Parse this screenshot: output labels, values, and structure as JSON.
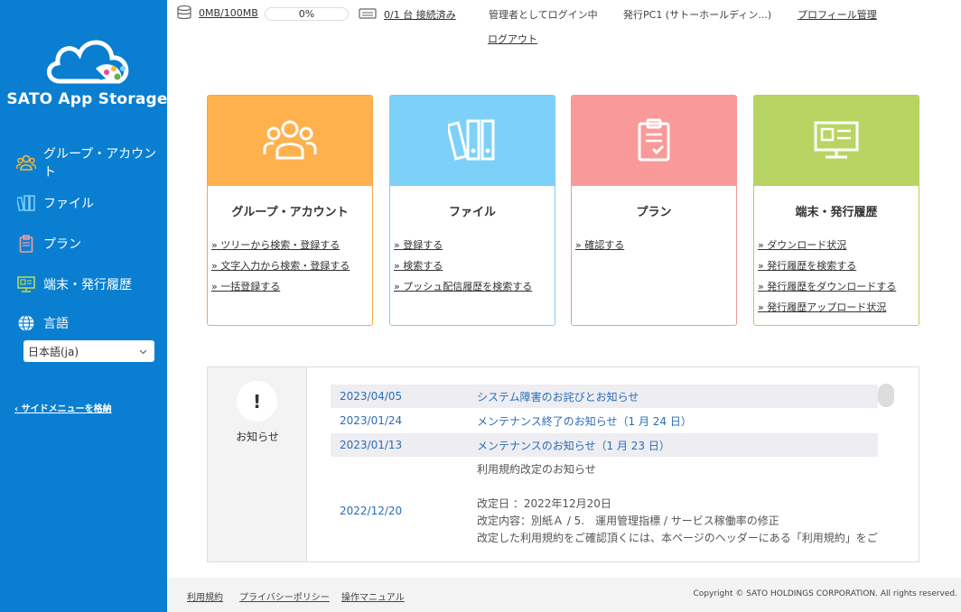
{
  "sidebar": {
    "logo_text": "SATO App Storage",
    "items": [
      {
        "label": "グループ・アカウント",
        "icon": "users-icon"
      },
      {
        "label": "ファイル",
        "icon": "folders-icon"
      },
      {
        "label": "プラン",
        "icon": "clipboard-icon"
      },
      {
        "label": "端末・発行履歴",
        "icon": "monitor-icon"
      },
      {
        "label": "言語",
        "icon": "globe-icon"
      }
    ],
    "language_value": "日本語(ja)",
    "collapse_label": "‹ サイドメニューを格納"
  },
  "header": {
    "storage": "0MB/100MB",
    "storage_percent": "0%",
    "devices": "0/1 台 接続済み",
    "login_status": "管理者としてログイン中",
    "issuing_pc": "発行PC1 (サトーホールディン...)",
    "profile_link": "プロフィール管理",
    "logout_link": "ログアウト"
  },
  "cards": [
    {
      "title": "グループ・アカウント",
      "color": "#ffb14e",
      "border": "#f4a94a",
      "icon": "users-icon",
      "links": [
        "» ツリーから検索・登録する",
        "» 文字入力から検索・登録する",
        "» 一括登録する"
      ]
    },
    {
      "title": "ファイル",
      "color": "#7dd1f8",
      "border": "#7dcdf2",
      "icon": "folders-icon",
      "links": [
        "» 登録する",
        "» 検索する",
        "» プッシュ配信履歴を検索する"
      ]
    },
    {
      "title": "プラン",
      "color": "#f99a99",
      "border": "#f59896",
      "icon": "clipboard-icon",
      "links": [
        "» 確認する"
      ]
    },
    {
      "title": "端末・発行履歴",
      "color": "#b8d563",
      "border": "#b3d05c",
      "icon": "monitor-icon",
      "links": [
        "» ダウンロード状況",
        "» 発行履歴を検索する",
        "» 発行履歴をダウンロードする",
        "» 発行履歴アップロード状況"
      ]
    }
  ],
  "news": {
    "label": "お知らせ",
    "items": [
      {
        "date": "2023/04/05",
        "title": "システム障害のお詫びとお知らせ"
      },
      {
        "date": "2023/01/24",
        "title": "メンテナンス終了のお知らせ（1 月 24 日）"
      },
      {
        "date": "2023/01/13",
        "title": "メンテナンスのお知らせ（1 月 23 日）"
      }
    ],
    "long_item": {
      "date": "2022/12/20",
      "lines": [
        "利用規約改定のお知らせ",
        "改定日 ：2022年12月20日",
        "改定内容：別紙Ａ / 5.　運用管理指標 / サービス稼働率の修正",
        "改定した利用規約をご確認頂くには、本ページのヘッダーにある「利用規約」をご"
      ]
    }
  },
  "footer": {
    "terms": "利用規約",
    "privacy": "プライバシーポリシー",
    "manual": "操作マニュアル",
    "copyright": "Copyright © SATO HOLDINGS CORPORATION. All rights reserved."
  }
}
